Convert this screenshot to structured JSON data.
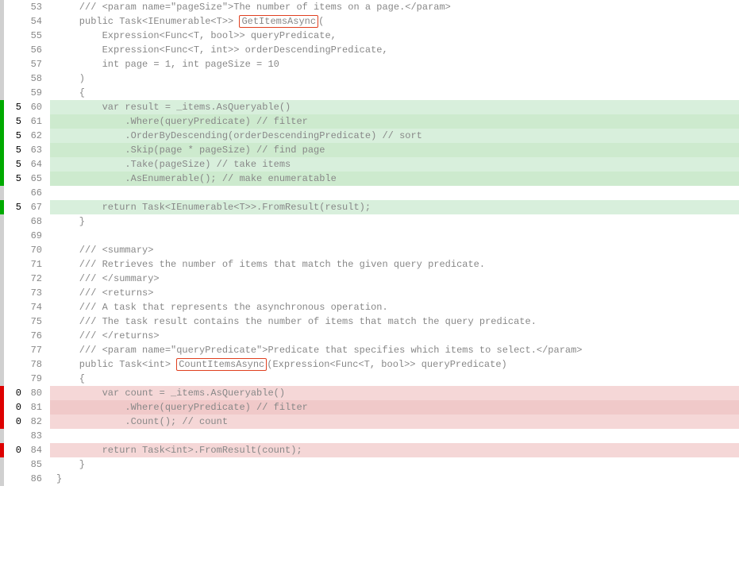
{
  "lines": [
    {
      "n": 53,
      "hits": "",
      "marker": "gray",
      "cov": "",
      "html": "    /// &lt;param name=\"pageSize\"&gt;The number of items on a page.&lt;/param&gt;"
    },
    {
      "n": 54,
      "hits": "",
      "marker": "gray",
      "cov": "",
      "html": "    public Task&lt;IEnumerable&lt;T&gt;&gt; <span class=\"highlight-box\" data-name=\"method-getitemsasync\">GetItemsAsync</span>("
    },
    {
      "n": 55,
      "hits": "",
      "marker": "gray",
      "cov": "",
      "html": "        Expression&lt;Func&lt;T, bool&gt;&gt; queryPredicate,"
    },
    {
      "n": 56,
      "hits": "",
      "marker": "gray",
      "cov": "",
      "html": "        Expression&lt;Func&lt;T, int&gt;&gt; orderDescendingPredicate,"
    },
    {
      "n": 57,
      "hits": "",
      "marker": "gray",
      "cov": "",
      "html": "        int page = 1, int pageSize = 10"
    },
    {
      "n": 58,
      "hits": "",
      "marker": "gray",
      "cov": "",
      "html": "    )"
    },
    {
      "n": 59,
      "hits": "",
      "marker": "gray",
      "cov": "",
      "html": "    {"
    },
    {
      "n": 60,
      "hits": "5",
      "marker": "green",
      "cov": "green",
      "html": "        var result = _items.AsQueryable()"
    },
    {
      "n": 61,
      "hits": "5",
      "marker": "green",
      "cov": "green",
      "html": "            .Where(queryPredicate) // filter"
    },
    {
      "n": 62,
      "hits": "5",
      "marker": "green",
      "cov": "green",
      "html": "            .OrderByDescending(orderDescendingPredicate) // sort"
    },
    {
      "n": 63,
      "hits": "5",
      "marker": "green",
      "cov": "green",
      "html": "            .Skip(page * pageSize) // find page"
    },
    {
      "n": 64,
      "hits": "5",
      "marker": "green",
      "cov": "green",
      "html": "            .Take(pageSize) // take items"
    },
    {
      "n": 65,
      "hits": "5",
      "marker": "green",
      "cov": "green",
      "html": "            .AsEnumerable(); // make enumeratable"
    },
    {
      "n": 66,
      "hits": "",
      "marker": "gray",
      "cov": "",
      "html": ""
    },
    {
      "n": 67,
      "hits": "5",
      "marker": "green",
      "cov": "green",
      "html": "        return Task&lt;IEnumerable&lt;T&gt;&gt;.FromResult(result);"
    },
    {
      "n": 68,
      "hits": "",
      "marker": "gray",
      "cov": "",
      "html": "    }"
    },
    {
      "n": 69,
      "hits": "",
      "marker": "gray",
      "cov": "",
      "html": ""
    },
    {
      "n": 70,
      "hits": "",
      "marker": "gray",
      "cov": "",
      "html": "    /// &lt;summary&gt;"
    },
    {
      "n": 71,
      "hits": "",
      "marker": "gray",
      "cov": "",
      "html": "    /// Retrieves the number of items that match the given query predicate."
    },
    {
      "n": 72,
      "hits": "",
      "marker": "gray",
      "cov": "",
      "html": "    /// &lt;/summary&gt;"
    },
    {
      "n": 73,
      "hits": "",
      "marker": "gray",
      "cov": "",
      "html": "    /// &lt;returns&gt;"
    },
    {
      "n": 74,
      "hits": "",
      "marker": "gray",
      "cov": "",
      "html": "    /// A task that represents the asynchronous operation."
    },
    {
      "n": 75,
      "hits": "",
      "marker": "gray",
      "cov": "",
      "html": "    /// The task result contains the number of items that match the query predicate."
    },
    {
      "n": 76,
      "hits": "",
      "marker": "gray",
      "cov": "",
      "html": "    /// &lt;/returns&gt;"
    },
    {
      "n": 77,
      "hits": "",
      "marker": "gray",
      "cov": "",
      "html": "    /// &lt;param name=\"queryPredicate\"&gt;Predicate that specifies which items to select.&lt;/param&gt;"
    },
    {
      "n": 78,
      "hits": "",
      "marker": "gray",
      "cov": "",
      "html": "    public Task&lt;int&gt; <span class=\"highlight-box\" data-name=\"method-countitemsasync\">CountItemsAsync</span>(Expression&lt;Func&lt;T, bool&gt;&gt; queryPredicate)"
    },
    {
      "n": 79,
      "hits": "",
      "marker": "gray",
      "cov": "",
      "html": "    {"
    },
    {
      "n": 80,
      "hits": "0",
      "marker": "red",
      "cov": "red",
      "html": "        var count = _items.AsQueryable()"
    },
    {
      "n": 81,
      "hits": "0",
      "marker": "red",
      "cov": "red",
      "html": "            .Where(queryPredicate) // filter"
    },
    {
      "n": 82,
      "hits": "0",
      "marker": "red",
      "cov": "red",
      "html": "            .Count(); // count"
    },
    {
      "n": 83,
      "hits": "",
      "marker": "gray",
      "cov": "",
      "html": ""
    },
    {
      "n": 84,
      "hits": "0",
      "marker": "red",
      "cov": "red",
      "html": "        return Task&lt;int&gt;.FromResult(count);"
    },
    {
      "n": 85,
      "hits": "",
      "marker": "gray",
      "cov": "",
      "html": "    }"
    },
    {
      "n": 86,
      "hits": "",
      "marker": "gray",
      "cov": "",
      "html": "}"
    }
  ]
}
